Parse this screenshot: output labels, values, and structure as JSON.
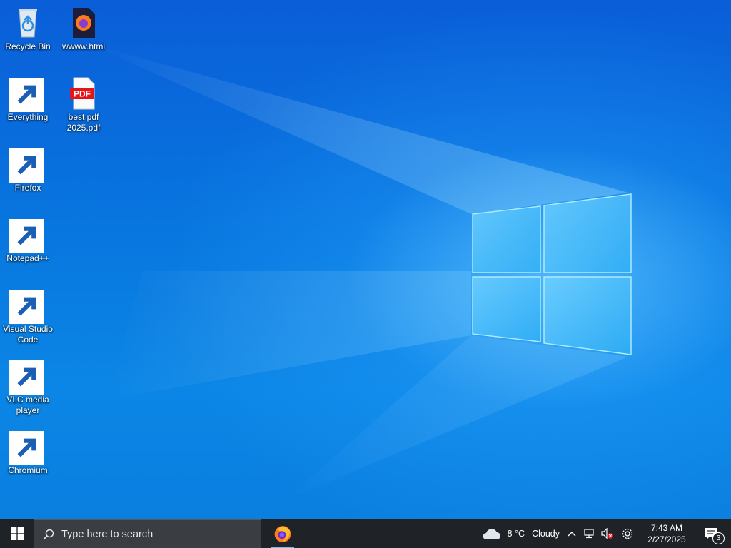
{
  "desktop": {
    "icons": [
      {
        "label": "Recycle Bin",
        "icon": "recycle-bin-icon",
        "shortcut": false
      },
      {
        "label": "wwww.html",
        "icon": "firefox-html-file-icon",
        "shortcut": false
      },
      {
        "label": "Everything",
        "icon": "everything-search-icon",
        "shortcut": true
      },
      {
        "label": "best pdf 2025.pdf",
        "icon": "pdf-file-icon",
        "shortcut": false,
        "badge": "PDF"
      },
      {
        "label": "Firefox",
        "icon": "firefox-icon",
        "shortcut": true
      },
      {
        "label": "Notepad++",
        "icon": "notepad-plus-plus-icon",
        "shortcut": true
      },
      {
        "label": "Visual Studio Code",
        "icon": "vscode-icon",
        "shortcut": true
      },
      {
        "label": "VLC media player",
        "icon": "vlc-icon",
        "shortcut": true
      },
      {
        "label": "Chromium",
        "icon": "chromium-icon",
        "shortcut": true
      }
    ]
  },
  "taskbar": {
    "search_placeholder": "Type here to search",
    "pinned": [
      {
        "name": "Firefox",
        "icon": "firefox-icon",
        "active": true
      }
    ],
    "weather": {
      "temp": "8 °C",
      "condition": "Cloudy",
      "icon": "cloud-icon"
    },
    "tray_icons": [
      "chevron-up-icon",
      "network-icon",
      "volume-muted-icon",
      "settings-gear-icon"
    ],
    "clock": {
      "time": "7:43 AM",
      "date": "2/27/2025"
    },
    "notifications": {
      "count": "3",
      "icon": "action-center-icon"
    }
  }
}
